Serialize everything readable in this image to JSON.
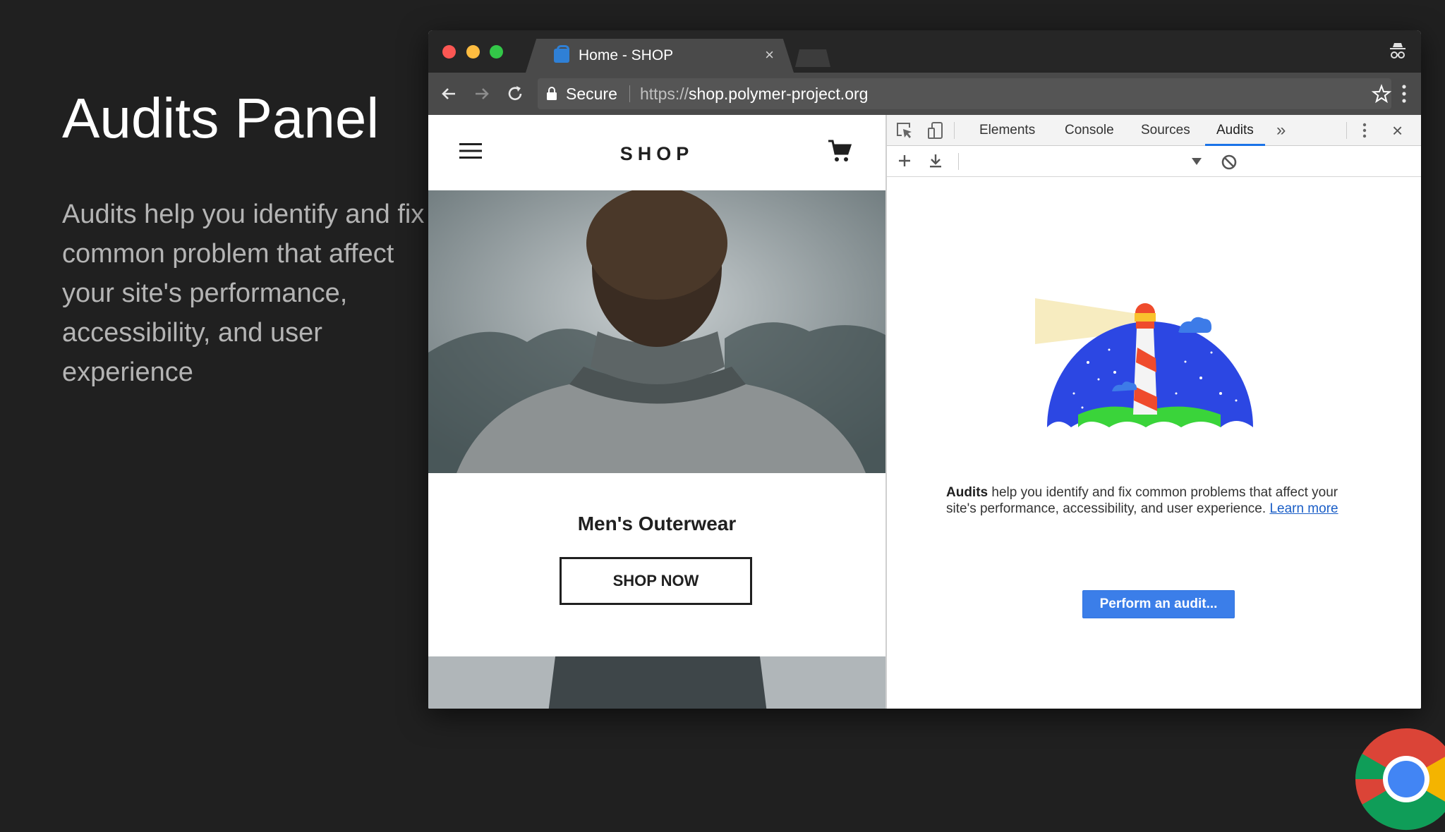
{
  "slide": {
    "title": "Audits Panel",
    "description": "Audits help you identify and fix common problem that affect your site's performance, accessibility, and user experience"
  },
  "browser": {
    "tab": {
      "title": "Home - SHOP",
      "close": "×",
      "favicon": "shop-favicon-icon"
    },
    "toolbar": {
      "back_icon": "arrow-left-icon",
      "forward_icon": "arrow-right-icon",
      "reload_icon": "reload-icon",
      "secure_label": "Secure",
      "url_scheme": "https://",
      "url_host": "shop.polymer-project.org",
      "bookmark_icon": "star-icon",
      "menu_icon": "kebab-menu-icon"
    },
    "incognito_icon": "incognito-icon",
    "traffic_lights": {
      "close": "#fc5753",
      "minimize": "#fdbc40",
      "zoom": "#33c748"
    }
  },
  "page": {
    "logo": "SHOP",
    "menu_icon": "hamburger-icon",
    "cart_icon": "cart-icon",
    "category_title": "Men's Outerwear",
    "shop_now_label": "SHOP NOW"
  },
  "devtools": {
    "tabs": [
      {
        "label": "Elements",
        "active": false
      },
      {
        "label": "Console",
        "active": false
      },
      {
        "label": "Sources",
        "active": false
      },
      {
        "label": "Audits",
        "active": true
      }
    ],
    "more_tabs": "»",
    "close": "×",
    "audits": {
      "description_bold": "Audits",
      "description_rest": " help you identify and fix common problems that affect your site's performance, accessibility, and user experience. ",
      "learn_more": "Learn more",
      "perform_button": "Perform an audit..."
    },
    "colors": {
      "accent": "#1a73e8",
      "button": "#3b7ee9"
    }
  }
}
